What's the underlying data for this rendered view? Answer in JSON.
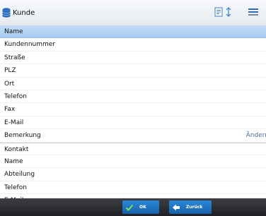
{
  "header": {
    "title": "Kunde",
    "icons": [
      "database-icon",
      "document-icon",
      "sort-icon",
      "menu-icon"
    ]
  },
  "fields": [
    {
      "label": "Name",
      "selected": true
    },
    {
      "label": "Kundennummer"
    },
    {
      "label": "Straße"
    },
    {
      "label": "PLZ"
    },
    {
      "label": "Ort"
    },
    {
      "label": "Telefon"
    },
    {
      "label": "Fax"
    },
    {
      "label": "E-Mail"
    },
    {
      "label": "Bemerkung",
      "action": "Ändern"
    },
    {
      "label": "Kontakt",
      "group_start": true
    },
    {
      "label": "Name"
    },
    {
      "label": "Abteilung"
    },
    {
      "label": "Telefon"
    },
    {
      "label": "E-Mail"
    }
  ],
  "footer": {
    "ok_label": "OK",
    "back_label": "Zurück"
  },
  "colors": {
    "selected_row": "#b4d3f3",
    "footer": "#2a2b2f",
    "button": "#1f74c4",
    "action_link": "#4a6f97"
  }
}
